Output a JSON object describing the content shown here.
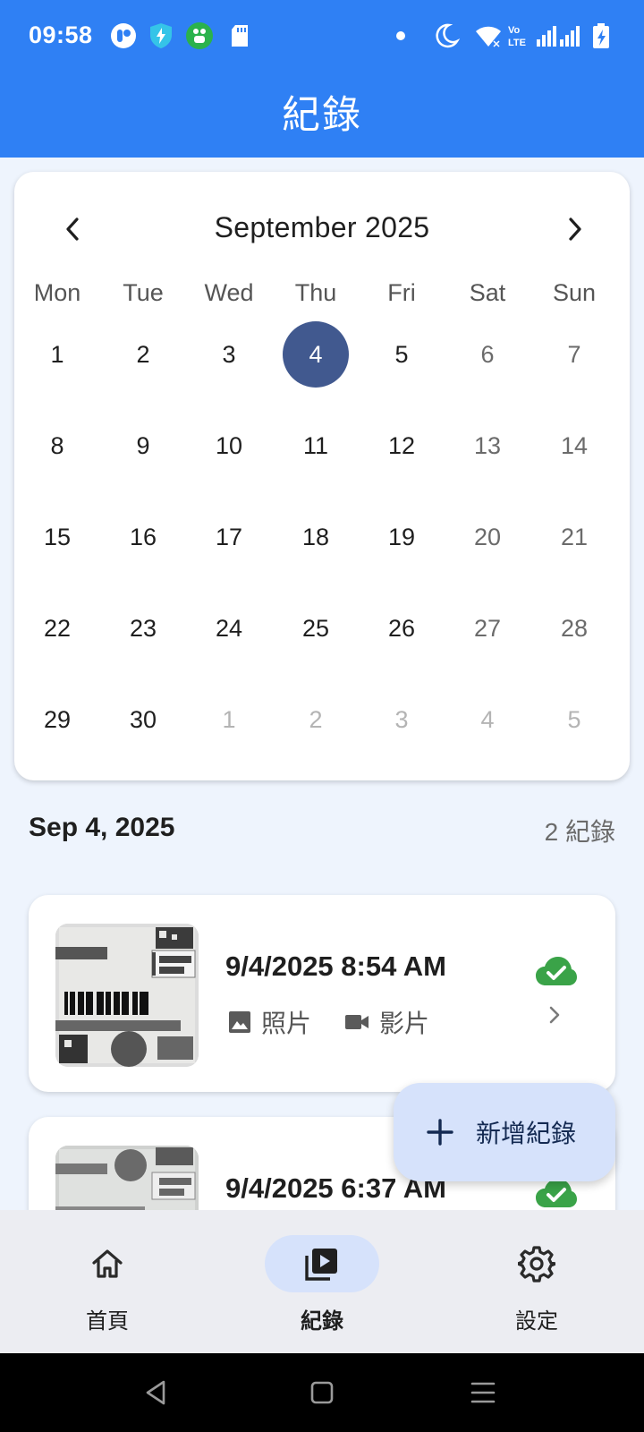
{
  "status_bar": {
    "time": "09:58",
    "left_icons": [
      "notification-app-icon",
      "shield-bolt-icon",
      "green-app-icon",
      "sd-card-icon"
    ],
    "right_icons": [
      "dot-icon",
      "moon-icon",
      "wifi-icon",
      "volte-icon",
      "signal-icon",
      "battery-charging-icon"
    ]
  },
  "app_bar": {
    "title": "紀錄"
  },
  "calendar": {
    "month_label": "September 2025",
    "weekdays": [
      "Mon",
      "Tue",
      "Wed",
      "Thu",
      "Fri",
      "Sat",
      "Sun"
    ],
    "weeks": [
      [
        "1",
        "2",
        "3",
        "4",
        "5",
        "6",
        "7"
      ],
      [
        "8",
        "9",
        "10",
        "11",
        "12",
        "13",
        "14"
      ],
      [
        "15",
        "16",
        "17",
        "18",
        "19",
        "20",
        "21"
      ],
      [
        "22",
        "23",
        "24",
        "25",
        "26",
        "27",
        "28"
      ],
      [
        "29",
        "30",
        "1",
        "2",
        "3",
        "4",
        "5"
      ]
    ],
    "selected_day": "4",
    "outside_month_from_index": 2
  },
  "selection": {
    "date_label": "Sep 4, 2025",
    "count_label": "2 紀錄"
  },
  "records": [
    {
      "title": "9/4/2025 8:54 AM",
      "photo_label": "照片",
      "video_label": "影片",
      "synced": true
    },
    {
      "title": "9/4/2025 6:37 AM",
      "synced": true
    }
  ],
  "fab": {
    "label": "新增紀錄"
  },
  "bottom_nav": [
    {
      "label": "首頁",
      "icon": "home-icon",
      "active": false
    },
    {
      "label": "紀錄",
      "icon": "video-library-icon",
      "active": true
    },
    {
      "label": "設定",
      "icon": "gear-icon",
      "active": false
    }
  ],
  "colors": {
    "primary": "#2f80f4",
    "selected_day": "#41598f",
    "fab_bg": "#d6e2fb",
    "sync_green": "#3aa348",
    "page_bg": "#eef4fd"
  }
}
